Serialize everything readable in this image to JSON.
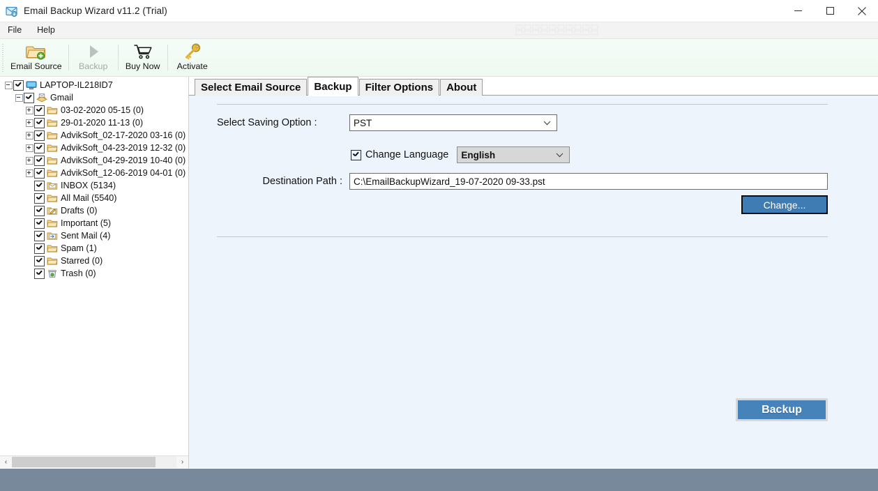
{
  "window": {
    "title": "Email Backup Wizard v11.2 (Trial)",
    "icon": "mail-app-icon",
    "minimize_label": "–",
    "maximize_label": "□",
    "close_label": "✕"
  },
  "menubar": {
    "items": [
      {
        "label": "File"
      },
      {
        "label": "Help"
      }
    ]
  },
  "toolbar": {
    "buttons": [
      {
        "label": "Email Source",
        "icon": "folder-add-icon",
        "enabled": true
      },
      {
        "label": "Backup",
        "icon": "play-triangle-icon",
        "enabled": false
      },
      {
        "label": "Buy Now",
        "icon": "shopping-cart-icon",
        "enabled": true
      },
      {
        "label": "Activate",
        "icon": "key-icon",
        "enabled": true
      }
    ]
  },
  "tree": {
    "nodes": [
      {
        "label": "LAPTOP-IL218ID7",
        "depth": 0,
        "expander": "minus",
        "icon": "computer-icon",
        "checked": true
      },
      {
        "label": "Gmail",
        "depth": 1,
        "expander": "minus",
        "icon": "mail-stack-icon",
        "checked": true
      },
      {
        "label": "03-02-2020 05-15 (0)",
        "depth": 2,
        "expander": "plus",
        "icon": "folder-icon",
        "checked": true
      },
      {
        "label": "29-01-2020 11-13 (0)",
        "depth": 2,
        "expander": "plus",
        "icon": "folder-icon",
        "checked": true
      },
      {
        "label": "AdvikSoft_02-17-2020 03-16 (0)",
        "depth": 2,
        "expander": "plus",
        "icon": "folder-icon",
        "checked": true
      },
      {
        "label": "AdvikSoft_04-23-2019 12-32 (0)",
        "depth": 2,
        "expander": "plus",
        "icon": "folder-icon",
        "checked": true
      },
      {
        "label": "AdvikSoft_04-29-2019 10-40 (0)",
        "depth": 2,
        "expander": "plus",
        "icon": "folder-icon",
        "checked": true
      },
      {
        "label": "AdvikSoft_12-06-2019 04-01 (0)",
        "depth": 2,
        "expander": "plus",
        "icon": "folder-icon",
        "checked": true
      },
      {
        "label": "INBOX (5134)",
        "depth": 2,
        "expander": "none",
        "icon": "inbox-envelope-icon",
        "checked": true
      },
      {
        "label": "All Mail (5540)",
        "depth": 2,
        "expander": "none",
        "icon": "folder-icon",
        "checked": true
      },
      {
        "label": "Drafts (0)",
        "depth": 2,
        "expander": "none",
        "icon": "drafts-pencil-icon",
        "checked": true
      },
      {
        "label": "Important (5)",
        "depth": 2,
        "expander": "none",
        "icon": "folder-icon",
        "checked": true
      },
      {
        "label": "Sent Mail (4)",
        "depth": 2,
        "expander": "none",
        "icon": "sent-mail-icon",
        "checked": true
      },
      {
        "label": "Spam (1)",
        "depth": 2,
        "expander": "none",
        "icon": "folder-icon",
        "checked": true
      },
      {
        "label": "Starred (0)",
        "depth": 2,
        "expander": "none",
        "icon": "folder-icon",
        "checked": true
      },
      {
        "label": "Trash (0)",
        "depth": 2,
        "expander": "none",
        "icon": "trash-icon",
        "checked": true
      }
    ],
    "scrollbar": {
      "left_arrow": "‹",
      "right_arrow": "›"
    }
  },
  "tabs": [
    {
      "label": "Select Email Source",
      "active": false
    },
    {
      "label": "Backup",
      "active": true
    },
    {
      "label": "Filter Options",
      "active": false
    },
    {
      "label": "About",
      "active": false
    }
  ],
  "backup_form": {
    "saving_option_label": "Select Saving Option :",
    "saving_option_value": "PST",
    "change_language_label": "Change Language",
    "change_language_checked": true,
    "language_value": "English",
    "destination_path_label": "Destination Path :",
    "destination_path_value": "C:\\EmailBackupWizard_19-07-2020 09-33.pst",
    "change_button_label": "Change...",
    "backup_button_label": "Backup"
  },
  "colors": {
    "accent_blue": "#4683bb",
    "change_button_blue": "#3f7cb4",
    "panel_bg": "#eef4fc",
    "toolbar_bg": "#f1fbf4",
    "statusbar": "#78899b"
  }
}
